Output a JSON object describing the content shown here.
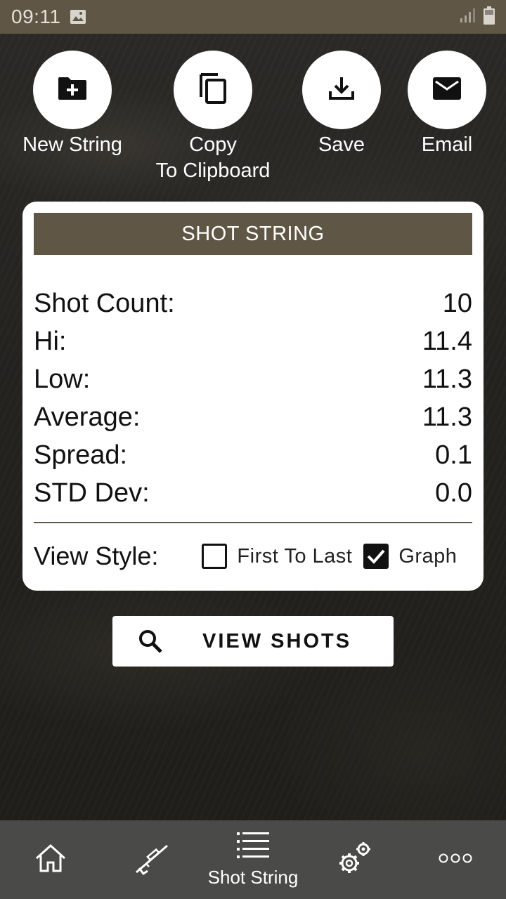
{
  "status_bar": {
    "time": "09:11",
    "icons": [
      "image-icon",
      "signal-icon",
      "battery-icon"
    ]
  },
  "actions": [
    {
      "id": "new-string",
      "icon": "folder-plus-icon",
      "label": "New String"
    },
    {
      "id": "copy",
      "icon": "copy-icon",
      "label_line1": "Copy",
      "label_line2": "To Clipboard"
    },
    {
      "id": "save",
      "icon": "download-icon",
      "label": "Save"
    },
    {
      "id": "email",
      "icon": "email-icon",
      "label": "Email"
    }
  ],
  "card": {
    "header": "SHOT STRING",
    "stats": [
      {
        "label": "Shot Count:",
        "value": "10"
      },
      {
        "label": "Hi:",
        "value": "11.4"
      },
      {
        "label": "Low:",
        "value": "11.3"
      },
      {
        "label": "Average:",
        "value": "11.3"
      },
      {
        "label": "Spread:",
        "value": "0.1"
      },
      {
        "label": "STD Dev:",
        "value": "0.0"
      }
    ],
    "view_style": {
      "label": "View Style:",
      "options": [
        {
          "label": "First To Last",
          "checked": false
        },
        {
          "label": "Graph",
          "checked": true
        }
      ]
    }
  },
  "view_shots_button": {
    "icon": "search-icon",
    "label": "VIEW SHOTS"
  },
  "bottom_nav": [
    {
      "icon": "home-icon",
      "label": ""
    },
    {
      "icon": "rifle-icon",
      "label": ""
    },
    {
      "icon": "list-icon",
      "label": "Shot String",
      "active": true
    },
    {
      "icon": "settings-icon",
      "label": ""
    },
    {
      "icon": "more-icon",
      "label": ""
    }
  ],
  "colors": {
    "accent": "#5f5645",
    "nav_bg": "#4a4a48",
    "card_bg": "#ffffff"
  }
}
